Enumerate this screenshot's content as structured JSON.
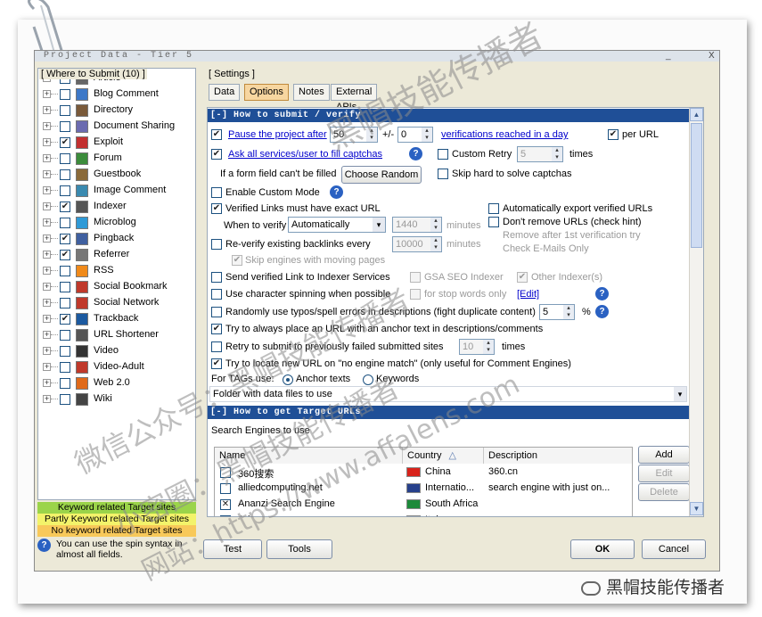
{
  "window": {
    "title": "Project Data - Tier 5",
    "minimize": "_",
    "close": "X"
  },
  "left_panel": {
    "title": "[ Where to Submit  (10) ]",
    "items": [
      {
        "label": "Article",
        "checked": false,
        "icon": "article-icon"
      },
      {
        "label": "Blog Comment",
        "checked": false,
        "icon": "blog-comment-icon"
      },
      {
        "label": "Directory",
        "checked": false,
        "icon": "directory-icon"
      },
      {
        "label": "Document Sharing",
        "checked": false,
        "icon": "document-sharing-icon"
      },
      {
        "label": "Exploit",
        "checked": true,
        "icon": "exploit-icon"
      },
      {
        "label": "Forum",
        "checked": false,
        "icon": "forum-icon"
      },
      {
        "label": "Guestbook",
        "checked": false,
        "icon": "guestbook-icon"
      },
      {
        "label": "Image Comment",
        "checked": false,
        "icon": "image-comment-icon"
      },
      {
        "label": "Indexer",
        "checked": true,
        "icon": "indexer-icon"
      },
      {
        "label": "Microblog",
        "checked": false,
        "icon": "microblog-icon"
      },
      {
        "label": "Pingback",
        "checked": true,
        "icon": "pingback-icon"
      },
      {
        "label": "Referrer",
        "checked": true,
        "icon": "referrer-icon"
      },
      {
        "label": "RSS",
        "checked": false,
        "icon": "rss-icon"
      },
      {
        "label": "Social Bookmark",
        "checked": false,
        "icon": "social-bookmark-icon"
      },
      {
        "label": "Social Network",
        "checked": false,
        "icon": "social-network-icon"
      },
      {
        "label": "Trackback",
        "checked": true,
        "icon": "trackback-icon"
      },
      {
        "label": "URL Shortener",
        "checked": false,
        "icon": "url-shortener-icon"
      },
      {
        "label": "Video",
        "checked": false,
        "icon": "video-icon"
      },
      {
        "label": "Video-Adult",
        "checked": false,
        "icon": "video-adult-icon"
      },
      {
        "label": "Web 2.0",
        "checked": false,
        "icon": "web20-icon"
      },
      {
        "label": "Wiki",
        "checked": false,
        "icon": "wiki-icon"
      }
    ],
    "legend": [
      {
        "label": "Keyword related Target sites",
        "color": "#9bd44a"
      },
      {
        "label": "Partly Keyword related Target sites",
        "color": "#f3f36a"
      },
      {
        "label": "No keyword related Target sites",
        "color": "#f8c95a"
      }
    ],
    "tip": "You can use the spin syntax in almost all fields."
  },
  "settings": {
    "group_label": "[ Settings ]",
    "tabs": [
      "Data",
      "Options",
      "Notes",
      "External APIs"
    ],
    "active_tab": "Options"
  },
  "submit": {
    "header": "[-] How to submit / verify",
    "pause_label": "Pause the project after",
    "pause_value": "50",
    "plusminus": "+/-",
    "plusminus_value": "0",
    "verifications_label": "verifications reached in a day",
    "per_url": "per URL",
    "ask_services": "Ask all services/user to fill captchas",
    "custom_retry": "Custom Retry",
    "custom_retry_value": "5",
    "times": "times",
    "form_field_label": "If a form field can't be filled",
    "choose_random": "Choose Random",
    "skip_hard": "Skip hard to solve captchas",
    "custom_mode": "Enable Custom Mode",
    "verified_exact": "Verified Links must have exact URL",
    "auto_export": "Automatically export verified URLs",
    "dont_remove": "Don't remove URLs (check hint)",
    "remove_after": "Remove after 1st verification try",
    "check_email": "Check E-Mails Only",
    "when_verify": "When to verify",
    "when_verify_value": "Automatically",
    "verify_minutes": "1440",
    "minutes": "minutes",
    "reverify": "Re-verify existing backlinks every",
    "reverify_value": "10000",
    "skip_moving": "Skip engines with moving pages",
    "send_verified": "Send verified Link to Indexer Services",
    "gsa_seo": "GSA SEO Indexer",
    "other_indexers": "Other Indexer(s)",
    "char_spinning": "Use character spinning when possible",
    "stop_words": "for stop words only",
    "edit": "[Edit]",
    "typos": "Randomly use typos/spell errors in descriptions (fight duplicate content)",
    "typos_value": "5",
    "percent": "%",
    "anchor_place": "Try to always place an URL with an anchor text in descriptions/comments",
    "retry_failed": "Retry to submit to previously failed submitted sites",
    "retry_value": "10",
    "locate_new": "Try to locate new URL on \"no engine match\" (only useful for Comment Engines)",
    "tags_use": "For TAGs use:",
    "anchor_texts": "Anchor texts",
    "keywords": "Keywords",
    "folder_label": "Folder with  data files to use"
  },
  "targets": {
    "header": "[-] How to get Target URLs",
    "engines_label": "Search Engines to use",
    "columns": [
      "Name",
      "Country",
      "Description"
    ],
    "rows": [
      {
        "name": "360搜索",
        "checked": false,
        "country": "China",
        "description": "360.cn",
        "flag": "#d8231b"
      },
      {
        "name": "alliedcomputing.net",
        "checked": false,
        "country": "Internatio...",
        "description": "search engine with just on...",
        "flag": "#27408b"
      },
      {
        "name": "Ananzi Search Engine",
        "checked": true,
        "country": "South Africa",
        "description": "",
        "flag": "#1c8a3a"
      },
      {
        "name": "Arianna",
        "checked": false,
        "country": "Italy",
        "description": "",
        "flag": "#0f8a3c"
      }
    ],
    "add": "Add",
    "edit": "Edit",
    "delete": "Delete"
  },
  "buttons": {
    "test": "Test",
    "tools": "Tools",
    "ok": "OK",
    "cancel": "Cancel"
  },
  "watermarks": {
    "top": "黑帽技能传播者",
    "wechat": "微信公众号：黑帽技能传播者",
    "circle": "小密圈：黑帽技能传播者",
    "site": "网站：https://www.affalens.com",
    "footer": "黑帽技能传播者"
  }
}
